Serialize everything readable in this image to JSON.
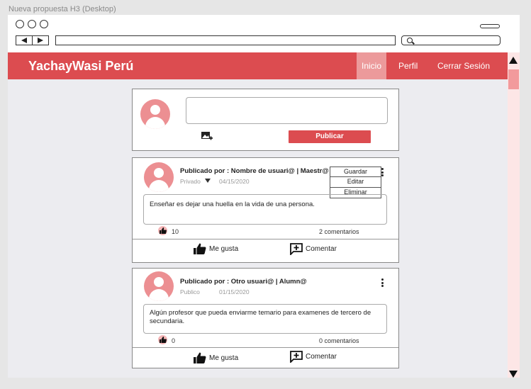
{
  "frame": {
    "title": "Nueva propuesta H3 (Desktop)"
  },
  "browser": {
    "url": "",
    "search": ""
  },
  "nav": {
    "brand": "YachayWasi Perú",
    "links": [
      {
        "label": "Inicio",
        "active": true
      },
      {
        "label": "Perfil",
        "active": false
      },
      {
        "label": "Cerrar Sesión",
        "active": false
      }
    ]
  },
  "compose": {
    "placeholder": "",
    "publish_label": "Publicar",
    "image_icon": "add-image-icon"
  },
  "posts": [
    {
      "author": "Publicado por : Nombre de usuari@ | Maestr@",
      "privacy": "Privado",
      "date": "04/15/2020",
      "body": "Enseñar es dejar una huella en la vida de una persona.",
      "likes": "10",
      "comments": "2 comentarios",
      "like_label": "Me gusta",
      "comment_label": "Comentar",
      "menu": [
        "Guardar",
        "Editar",
        "Eliminar"
      ]
    },
    {
      "author": "Publicado por : Otro usuari@ | Alumn@",
      "privacy": "Publico",
      "date": "01/15/2020",
      "body": "Algún profesor que pueda enviarme temario para examenes de tercero de secundaria.",
      "likes": "0",
      "comments": "0 comentarios",
      "like_label": "Me gusta",
      "comment_label": "Comentar"
    }
  ],
  "colors": {
    "brand": "#dc4c50",
    "active_tab": "#ec9a9b",
    "avatar": "#ec8f92",
    "background": "#ececf0"
  }
}
